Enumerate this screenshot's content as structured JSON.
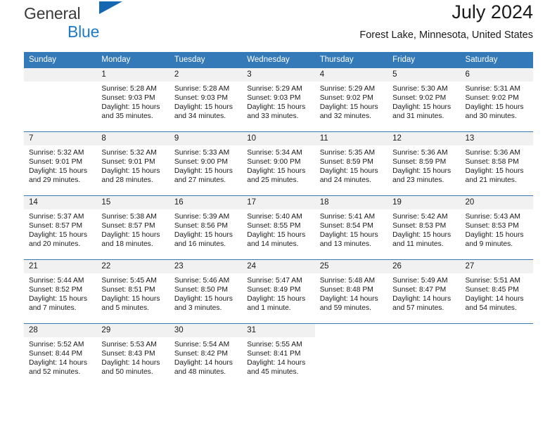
{
  "brand": {
    "name_top": "General",
    "name_bottom": "Blue",
    "triangle_color": "#1667b2",
    "blue_color": "#1f7ac4"
  },
  "header": {
    "title": "July 2024",
    "subtitle": "Forest Lake, Minnesota, United States"
  },
  "theme": {
    "header_blue": "#3479b8",
    "daynum_gray": "#f1f1f1"
  },
  "weekdays": [
    "Sunday",
    "Monday",
    "Tuesday",
    "Wednesday",
    "Thursday",
    "Friday",
    "Saturday"
  ],
  "weeks": [
    [
      {
        "day": "",
        "sunrise": "",
        "sunset": "",
        "daylight1": "",
        "daylight2": ""
      },
      {
        "day": "1",
        "sunrise": "Sunrise: 5:28 AM",
        "sunset": "Sunset: 9:03 PM",
        "daylight1": "Daylight: 15 hours",
        "daylight2": "and 35 minutes."
      },
      {
        "day": "2",
        "sunrise": "Sunrise: 5:28 AM",
        "sunset": "Sunset: 9:03 PM",
        "daylight1": "Daylight: 15 hours",
        "daylight2": "and 34 minutes."
      },
      {
        "day": "3",
        "sunrise": "Sunrise: 5:29 AM",
        "sunset": "Sunset: 9:03 PM",
        "daylight1": "Daylight: 15 hours",
        "daylight2": "and 33 minutes."
      },
      {
        "day": "4",
        "sunrise": "Sunrise: 5:29 AM",
        "sunset": "Sunset: 9:02 PM",
        "daylight1": "Daylight: 15 hours",
        "daylight2": "and 32 minutes."
      },
      {
        "day": "5",
        "sunrise": "Sunrise: 5:30 AM",
        "sunset": "Sunset: 9:02 PM",
        "daylight1": "Daylight: 15 hours",
        "daylight2": "and 31 minutes."
      },
      {
        "day": "6",
        "sunrise": "Sunrise: 5:31 AM",
        "sunset": "Sunset: 9:02 PM",
        "daylight1": "Daylight: 15 hours",
        "daylight2": "and 30 minutes."
      }
    ],
    [
      {
        "day": "7",
        "sunrise": "Sunrise: 5:32 AM",
        "sunset": "Sunset: 9:01 PM",
        "daylight1": "Daylight: 15 hours",
        "daylight2": "and 29 minutes."
      },
      {
        "day": "8",
        "sunrise": "Sunrise: 5:32 AM",
        "sunset": "Sunset: 9:01 PM",
        "daylight1": "Daylight: 15 hours",
        "daylight2": "and 28 minutes."
      },
      {
        "day": "9",
        "sunrise": "Sunrise: 5:33 AM",
        "sunset": "Sunset: 9:00 PM",
        "daylight1": "Daylight: 15 hours",
        "daylight2": "and 27 minutes."
      },
      {
        "day": "10",
        "sunrise": "Sunrise: 5:34 AM",
        "sunset": "Sunset: 9:00 PM",
        "daylight1": "Daylight: 15 hours",
        "daylight2": "and 25 minutes."
      },
      {
        "day": "11",
        "sunrise": "Sunrise: 5:35 AM",
        "sunset": "Sunset: 8:59 PM",
        "daylight1": "Daylight: 15 hours",
        "daylight2": "and 24 minutes."
      },
      {
        "day": "12",
        "sunrise": "Sunrise: 5:36 AM",
        "sunset": "Sunset: 8:59 PM",
        "daylight1": "Daylight: 15 hours",
        "daylight2": "and 23 minutes."
      },
      {
        "day": "13",
        "sunrise": "Sunrise: 5:36 AM",
        "sunset": "Sunset: 8:58 PM",
        "daylight1": "Daylight: 15 hours",
        "daylight2": "and 21 minutes."
      }
    ],
    [
      {
        "day": "14",
        "sunrise": "Sunrise: 5:37 AM",
        "sunset": "Sunset: 8:57 PM",
        "daylight1": "Daylight: 15 hours",
        "daylight2": "and 20 minutes."
      },
      {
        "day": "15",
        "sunrise": "Sunrise: 5:38 AM",
        "sunset": "Sunset: 8:57 PM",
        "daylight1": "Daylight: 15 hours",
        "daylight2": "and 18 minutes."
      },
      {
        "day": "16",
        "sunrise": "Sunrise: 5:39 AM",
        "sunset": "Sunset: 8:56 PM",
        "daylight1": "Daylight: 15 hours",
        "daylight2": "and 16 minutes."
      },
      {
        "day": "17",
        "sunrise": "Sunrise: 5:40 AM",
        "sunset": "Sunset: 8:55 PM",
        "daylight1": "Daylight: 15 hours",
        "daylight2": "and 14 minutes."
      },
      {
        "day": "18",
        "sunrise": "Sunrise: 5:41 AM",
        "sunset": "Sunset: 8:54 PM",
        "daylight1": "Daylight: 15 hours",
        "daylight2": "and 13 minutes."
      },
      {
        "day": "19",
        "sunrise": "Sunrise: 5:42 AM",
        "sunset": "Sunset: 8:53 PM",
        "daylight1": "Daylight: 15 hours",
        "daylight2": "and 11 minutes."
      },
      {
        "day": "20",
        "sunrise": "Sunrise: 5:43 AM",
        "sunset": "Sunset: 8:53 PM",
        "daylight1": "Daylight: 15 hours",
        "daylight2": "and 9 minutes."
      }
    ],
    [
      {
        "day": "21",
        "sunrise": "Sunrise: 5:44 AM",
        "sunset": "Sunset: 8:52 PM",
        "daylight1": "Daylight: 15 hours",
        "daylight2": "and 7 minutes."
      },
      {
        "day": "22",
        "sunrise": "Sunrise: 5:45 AM",
        "sunset": "Sunset: 8:51 PM",
        "daylight1": "Daylight: 15 hours",
        "daylight2": "and 5 minutes."
      },
      {
        "day": "23",
        "sunrise": "Sunrise: 5:46 AM",
        "sunset": "Sunset: 8:50 PM",
        "daylight1": "Daylight: 15 hours",
        "daylight2": "and 3 minutes."
      },
      {
        "day": "24",
        "sunrise": "Sunrise: 5:47 AM",
        "sunset": "Sunset: 8:49 PM",
        "daylight1": "Daylight: 15 hours",
        "daylight2": "and 1 minute."
      },
      {
        "day": "25",
        "sunrise": "Sunrise: 5:48 AM",
        "sunset": "Sunset: 8:48 PM",
        "daylight1": "Daylight: 14 hours",
        "daylight2": "and 59 minutes."
      },
      {
        "day": "26",
        "sunrise": "Sunrise: 5:49 AM",
        "sunset": "Sunset: 8:47 PM",
        "daylight1": "Daylight: 14 hours",
        "daylight2": "and 57 minutes."
      },
      {
        "day": "27",
        "sunrise": "Sunrise: 5:51 AM",
        "sunset": "Sunset: 8:45 PM",
        "daylight1": "Daylight: 14 hours",
        "daylight2": "and 54 minutes."
      }
    ],
    [
      {
        "day": "28",
        "sunrise": "Sunrise: 5:52 AM",
        "sunset": "Sunset: 8:44 PM",
        "daylight1": "Daylight: 14 hours",
        "daylight2": "and 52 minutes."
      },
      {
        "day": "29",
        "sunrise": "Sunrise: 5:53 AM",
        "sunset": "Sunset: 8:43 PM",
        "daylight1": "Daylight: 14 hours",
        "daylight2": "and 50 minutes."
      },
      {
        "day": "30",
        "sunrise": "Sunrise: 5:54 AM",
        "sunset": "Sunset: 8:42 PM",
        "daylight1": "Daylight: 14 hours",
        "daylight2": "and 48 minutes."
      },
      {
        "day": "31",
        "sunrise": "Sunrise: 5:55 AM",
        "sunset": "Sunset: 8:41 PM",
        "daylight1": "Daylight: 14 hours",
        "daylight2": "and 45 minutes."
      },
      {
        "day": "",
        "sunrise": "",
        "sunset": "",
        "daylight1": "",
        "daylight2": ""
      },
      {
        "day": "",
        "sunrise": "",
        "sunset": "",
        "daylight1": "",
        "daylight2": ""
      },
      {
        "day": "",
        "sunrise": "",
        "sunset": "",
        "daylight1": "",
        "daylight2": ""
      }
    ]
  ]
}
